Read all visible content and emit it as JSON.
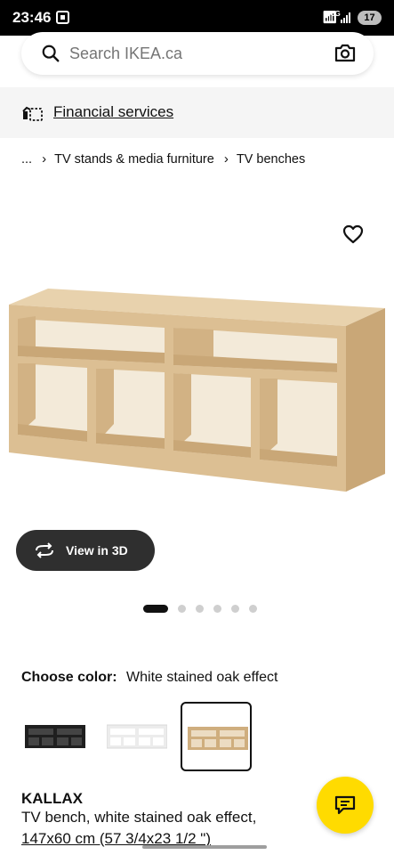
{
  "status_bar": {
    "time": "23:46",
    "network": "5G",
    "battery": "17"
  },
  "search": {
    "placeholder": "Search IKEA.ca"
  },
  "financial": {
    "label": "Financial services"
  },
  "breadcrumb": {
    "items": [
      "...",
      "TV stands & media furniture",
      "TV benches"
    ]
  },
  "view_3d": {
    "label": "View in 3D"
  },
  "carousel": {
    "count": 6,
    "active_index": 0
  },
  "color": {
    "label": "Choose color:",
    "selected_value": "White stained oak effect",
    "options": [
      {
        "name": "black-brown",
        "color": "#1f1f1f"
      },
      {
        "name": "white",
        "color": "#f2f2f2"
      },
      {
        "name": "white stained oak effect",
        "color": "#d7b98e"
      }
    ]
  },
  "product": {
    "name": "KALLAX",
    "description": "TV bench, white stained oak effect,",
    "dimensions": "147x60 cm (57 3/4x23 1/2 \")"
  },
  "icons": {
    "search": "search-icon",
    "camera": "camera-icon",
    "financial": "financial-services-icon",
    "favorite": "heart-icon",
    "view3d": "rotate-3d-icon",
    "chat": "chat-icon"
  },
  "colors": {
    "brand_yellow": "#ffdb00",
    "dark_button": "#2f2f2f",
    "wood": "#d7b98e"
  }
}
